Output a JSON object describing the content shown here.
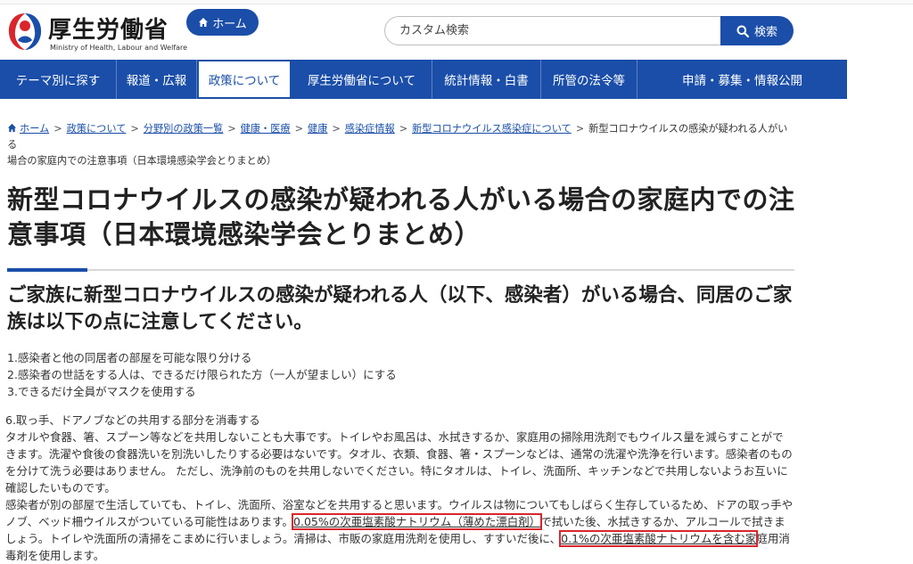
{
  "header": {
    "logo_jp": "厚生労働省",
    "logo_en": "Ministry of Health, Labour and Welfare",
    "home_label": "ホーム",
    "search_placeholder": "カスタム検索",
    "search_label": "検索"
  },
  "nav": {
    "items": [
      {
        "label": "テーマ別に探す"
      },
      {
        "label": "報道・広報"
      },
      {
        "label": "政策について",
        "active": true
      },
      {
        "label": "厚生労働省について"
      },
      {
        "label": "統計情報・白書"
      },
      {
        "label": "所管の法令等"
      },
      {
        "label": "申請・募集・情報公開"
      }
    ]
  },
  "breadcrumb": {
    "items": [
      "ホーム",
      "政策について",
      "分野別の政策一覧",
      "健康・医療",
      "健康",
      "感染症情報",
      "新型コロナウイルス感染症について"
    ],
    "current_line1": "新型コロナウイルスの感染が疑われる人がいる",
    "current_line2": "場合の家庭内での注意事項（日本環境感染学会とりまとめ）"
  },
  "page": {
    "title": "新型コロナウイルスの感染が疑われる人がいる場合の家庭内での注意事項（日本環境感染学会とりまとめ）",
    "subtitle": "ご家族に新型コロナウイルスの感染が疑われる人（以下、感染者）がいる場合、同居のご家族は以下の点に注意してください。",
    "points": [
      "1.感染者と他の同居者の部屋を可能な限り分ける",
      "2.感染者の世話をする人は、できるだけ限られた方（一人が望ましい）にする",
      "3.できるだけ全員がマスクを使用する"
    ],
    "section6_heading": "6.取っ手、ドアノブなどの共用する部分を消毒する",
    "para1": "タオルや食器、箸、スプーン等などを共用しないことも大事です。トイレやお風呂は、水拭きするか、家庭用の掃除用洗剤でもウイルス量を減らすことができます。洗濯や食後の食器洗いを別洗いしたりする必要はないです。タオル、衣類、食器、箸・スプーンなどは、通常の洗濯や洗浄を行います。感染者のものを分けて洗う必要はありません。 ただし、洗浄前のものを共用しないでください。特にタオルは、トイレ、洗面所、キッチンなどで共用しないようお互いに確認したいものです。",
    "para2_a": "感染者が別の部屋で生活していても、トイレ、洗面所、浴室などを共用すると思います。ウイルスは物についてもしばらく生存しているため、ドアの取っ手やノブ、ベッド柵ウイルスがついている可能性はあります。",
    "para2_hl1": "0.05%の次亜塩素酸ナトリウム（薄めた漂白剤）",
    "para2_b": "で拭いた後、水拭きするか、アルコールで拭きましょう。トイレや洗面所の清掃をこまめに行いましょう。清掃は、市販の家庭用洗剤を使用し、すすいだ後に、",
    "para2_hl2": "0.1%の次亜塩素酸ナトリウムを含む家",
    "para2_c": "庭用消毒剤を使用します。"
  },
  "colors": {
    "brand_blue": "#1a4ea8",
    "highlight_red": "#d9262c"
  }
}
